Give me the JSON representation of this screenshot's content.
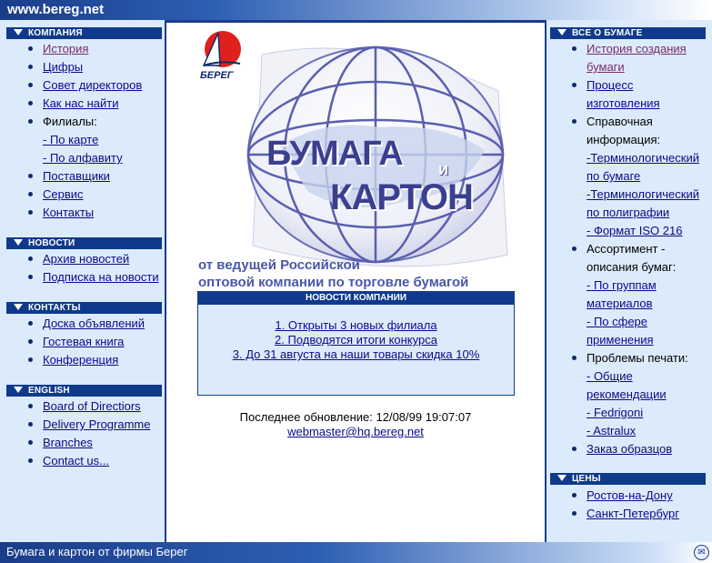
{
  "site_url": "www.bereg.net",
  "footer_text": "Бумага и картон от фирмы Берег",
  "left": {
    "company": {
      "title": "КОМПАНИЯ",
      "items": [
        "История",
        "Цифры",
        "Совет директоров",
        "Как нас найти",
        "Филиалы:",
        "- По карте",
        "- По алфавиту",
        "Поставщики",
        "Сервис",
        "Контакты"
      ]
    },
    "news": {
      "title": "НОВОСТИ",
      "items": [
        "Архив новостей",
        "Подписка на новости"
      ]
    },
    "contacts": {
      "title": "КОНТАКТЫ",
      "items": [
        "Доска объявлений",
        "Гостевая книга",
        "Конференция"
      ]
    },
    "english": {
      "title": "ENGLISH",
      "items": [
        "Board of Directiors",
        "Delivery Programme",
        "Branches",
        "Contact us..."
      ]
    }
  },
  "right": {
    "paper": {
      "title": "ВСЕ О БУМАГЕ",
      "lines": [
        "История создания",
        "бумаги",
        "Процесс",
        "изготовления",
        "Справочная",
        "информация:",
        "-Терминологический",
        "по бумаге",
        "-Терминологический",
        "по полиграфии",
        "- Формат ISO 216",
        "Ассортимент -",
        "описания бумаг:",
        "- По группам",
        "материалов",
        "- По сфере",
        "применения",
        "Проблемы печати:",
        "- Общие",
        "рекомендации",
        "- Fedrigoni",
        "- Astralux",
        "Заказ образцов"
      ]
    },
    "prices": {
      "title": "ЦЕНЫ",
      "items": [
        "Ростов-на-Дону",
        "Санкт-Петербург"
      ]
    }
  },
  "main": {
    "logo_text": "БЕРЕГ",
    "hero": {
      "line1": "БУМАГА",
      "and": "и",
      "line2": "КАРТОН"
    },
    "tagline1": "от ведущей Российской",
    "tagline2": "оптовой компании по торговле бумагой",
    "news_box": {
      "title": "НОВОСТИ КОМПАНИИ",
      "items": [
        "1. Открыты 3 новых филиала",
        "2. Подводятся итоги конкурса",
        "3. До 31 августа на наши товары скидка 10%"
      ]
    },
    "updated": "Последнее обновление: 12/08/99 19:07:07",
    "email": "webmaster@hq.bereg.net"
  },
  "colors": {
    "navy": "#0f3a8c",
    "sidebar_bg": "#dcebfb",
    "link": "#0a0a8a",
    "visited": "#7a2b6b",
    "hero_text": "#3b3f8f"
  }
}
